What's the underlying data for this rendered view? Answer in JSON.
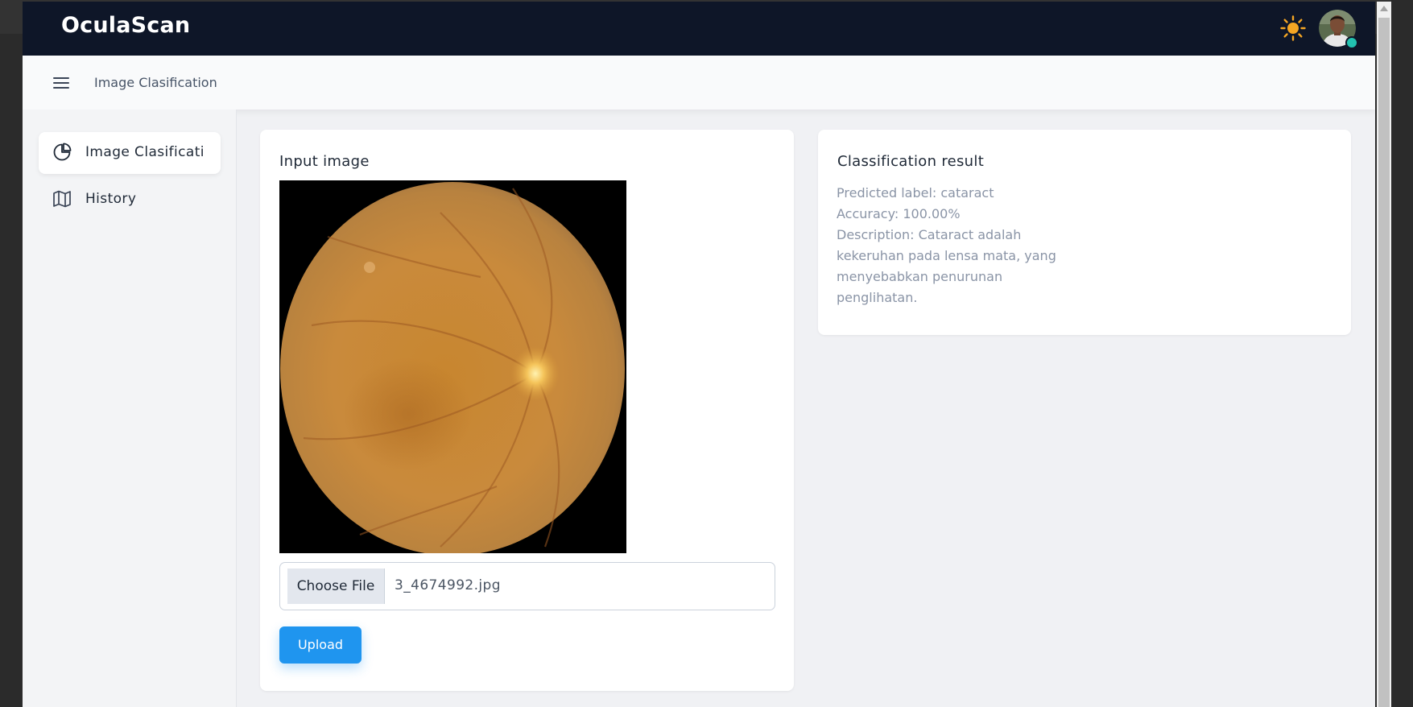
{
  "header": {
    "brand": "OculaScan",
    "theme_icon": "sun-icon",
    "avatar_icon": "user-avatar",
    "status_color": "#22c2b0"
  },
  "subheader": {
    "menu_icon": "hamburger-icon",
    "title": "Image Clasification"
  },
  "sidebar": {
    "items": [
      {
        "label": "Image Clasification",
        "icon": "pie-chart-icon",
        "active": true
      },
      {
        "label": "History",
        "icon": "map-icon",
        "active": false
      }
    ]
  },
  "input_card": {
    "title": "Input image",
    "choose_file_label": "Choose File",
    "file_name": "3_4674992.jpg",
    "upload_label": "Upload"
  },
  "result_card": {
    "title": "Classification result",
    "lines": [
      "Predicted label: cataract",
      "Accuracy: 100.00%",
      "Description: Cataract adalah",
      "kekeruhan pada lensa mata, yang",
      "menyebabkan penurunan",
      "penglihatan."
    ]
  },
  "colors": {
    "topbar": "#0e1628",
    "accent": "#1f95ef",
    "sun": "#f5a623"
  }
}
